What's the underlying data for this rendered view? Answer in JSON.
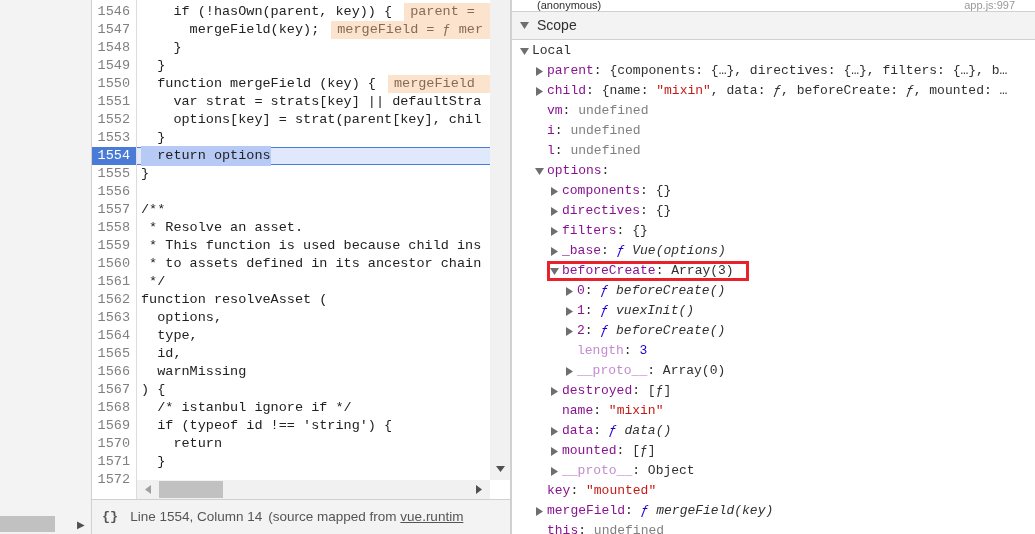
{
  "navigator": {
    "arrow": "▶"
  },
  "editor": {
    "lines": [
      {
        "number": "1546",
        "code": "    if (!hasOwn(parent, key)) {",
        "inline_value": "parent = ",
        "current": false
      },
      {
        "number": "1547",
        "code": "      mergeField(key);",
        "inline_value": "mergeField = ƒ mer",
        "current": false
      },
      {
        "number": "1548",
        "code": "    }",
        "current": false
      },
      {
        "number": "1549",
        "code": "  }",
        "current": false
      },
      {
        "number": "1550",
        "code": "  function mergeField (key) {",
        "inline_value": "mergeField ",
        "current": false
      },
      {
        "number": "1551",
        "code": "    var strat = strats[key] || defaultStra",
        "current": false
      },
      {
        "number": "1552",
        "code": "    options[key] = strat(parent[key], chil",
        "current": false
      },
      {
        "number": "1553",
        "code": "  }",
        "current": false
      },
      {
        "number": "1554",
        "code": "  return options",
        "current": true
      },
      {
        "number": "1555",
        "code": "}",
        "current": false
      },
      {
        "number": "1556",
        "current": false
      },
      {
        "number": "1557",
        "code": "/**",
        "current": false
      },
      {
        "number": "1558",
        "code": " * Resolve an asset.",
        "current": false
      },
      {
        "number": "1559",
        "code": " * This function is used because child ins",
        "current": false
      },
      {
        "number": "1560",
        "code": " * to assets defined in its ancestor chain",
        "current": false
      },
      {
        "number": "1561",
        "code": " */",
        "current": false
      },
      {
        "number": "1562",
        "code": "function resolveAsset (",
        "current": false
      },
      {
        "number": "1563",
        "code": "  options,",
        "current": false
      },
      {
        "number": "1564",
        "code": "  type,",
        "current": false
      },
      {
        "number": "1565",
        "code": "  id,",
        "current": false
      },
      {
        "number": "1566",
        "code": "  warnMissing",
        "current": false
      },
      {
        "number": "1567",
        "code": ") {",
        "current": false
      },
      {
        "number": "1568",
        "code": "  /* istanbul ignore if */",
        "current": false
      },
      {
        "number": "1569",
        "code": "  if (typeof id !== 'string') {",
        "current": false
      },
      {
        "number": "1570",
        "code": "    return",
        "current": false
      },
      {
        "number": "1571",
        "code": "  }",
        "current": false
      },
      {
        "number": "1572",
        "current": false
      }
    ]
  },
  "status_bar": {
    "format_icon": "{}",
    "position": "Line 1554, Column 14",
    "source_prefix": "(source mapped from ",
    "source_link": "vue.runtim"
  },
  "call_stack": {
    "frame": "(anonymous)",
    "location": "app.js:997"
  },
  "scope": {
    "title": "Scope",
    "expanded": true,
    "tree": [
      {
        "key": "Local",
        "kind": "section",
        "expanded": true,
        "boxed": false,
        "children": [
          {
            "key": "parent",
            "separator": ":",
            "dimmed": false,
            "expanded": false,
            "boxed": false,
            "value": [
              {
                "text": "{components: {…}, directives: {…}, filters: {…}, b…",
                "kind": "plain"
              }
            ]
          },
          {
            "key": "child",
            "separator": ":",
            "dimmed": false,
            "expanded": false,
            "boxed": false,
            "value": [
              {
                "text": "{name: ",
                "kind": "plain"
              },
              {
                "text": "\"mixin\"",
                "kind": "string"
              },
              {
                "text": ", data: ",
                "kind": "plain"
              },
              {
                "text": "ƒ",
                "kind": "fname"
              },
              {
                "text": ", beforeCreate: ",
                "kind": "plain"
              },
              {
                "text": "ƒ",
                "kind": "fname"
              },
              {
                "text": ", mounted: …",
                "kind": "plain"
              }
            ]
          },
          {
            "key": "vm",
            "separator": ":",
            "dimmed": false,
            "boxed": false,
            "value": [
              {
                "text": "undefined",
                "kind": "undefined"
              }
            ]
          },
          {
            "key": "i",
            "separator": ":",
            "dimmed": false,
            "boxed": false,
            "value": [
              {
                "text": "undefined",
                "kind": "undefined"
              }
            ]
          },
          {
            "key": "l",
            "separator": ":",
            "dimmed": false,
            "boxed": false,
            "value": [
              {
                "text": "undefined",
                "kind": "undefined"
              }
            ]
          },
          {
            "key": "options",
            "separator": ":",
            "dimmed": false,
            "expanded": true,
            "boxed": false,
            "children": [
              {
                "key": "components",
                "separator": ":",
                "dimmed": false,
                "expanded": false,
                "boxed": false,
                "value": [
                  {
                    "text": "{}",
                    "kind": "plain"
                  }
                ]
              },
              {
                "key": "directives",
                "separator": ":",
                "dimmed": false,
                "expanded": false,
                "boxed": false,
                "value": [
                  {
                    "text": "{}",
                    "kind": "plain"
                  }
                ]
              },
              {
                "key": "filters",
                "separator": ":",
                "dimmed": false,
                "expanded": false,
                "boxed": false,
                "value": [
                  {
                    "text": "{}",
                    "kind": "plain"
                  }
                ]
              },
              {
                "key": "_base",
                "separator": ":",
                "dimmed": false,
                "expanded": false,
                "boxed": false,
                "value": [
                  {
                    "text": "ƒ",
                    "kind": "fn"
                  },
                  {
                    "text": "Vue(options)",
                    "kind": "fname"
                  }
                ]
              },
              {
                "key": "beforeCreate",
                "separator": ":",
                "dimmed": false,
                "expanded": true,
                "boxed": true,
                "value": [
                  {
                    "text": "Array(3)",
                    "kind": "plain"
                  }
                ],
                "children": [
                  {
                    "key": "0",
                    "separator": ":",
                    "dimmed": false,
                    "expanded": false,
                    "boxed": false,
                    "value": [
                      {
                        "text": "ƒ",
                        "kind": "fn"
                      },
                      {
                        "text": "beforeCreate()",
                        "kind": "fname"
                      }
                    ]
                  },
                  {
                    "key": "1",
                    "separator": ":",
                    "dimmed": false,
                    "expanded": false,
                    "boxed": false,
                    "value": [
                      {
                        "text": "ƒ",
                        "kind": "fn"
                      },
                      {
                        "text": "vuexInit()",
                        "kind": "fname"
                      }
                    ]
                  },
                  {
                    "key": "2",
                    "separator": ":",
                    "dimmed": false,
                    "expanded": false,
                    "boxed": false,
                    "value": [
                      {
                        "text": "ƒ",
                        "kind": "fn"
                      },
                      {
                        "text": "beforeCreate()",
                        "kind": "fname"
                      }
                    ]
                  },
                  {
                    "key": "length",
                    "separator": ":",
                    "dimmed": true,
                    "boxed": false,
                    "value": [
                      {
                        "text": "3",
                        "kind": "number"
                      }
                    ]
                  },
                  {
                    "key": "__proto__",
                    "separator": ":",
                    "dimmed": true,
                    "expanded": false,
                    "boxed": false,
                    "value": [
                      {
                        "text": "Array(0)",
                        "kind": "plain"
                      }
                    ]
                  }
                ]
              },
              {
                "key": "destroyed",
                "separator": ":",
                "dimmed": false,
                "expanded": false,
                "boxed": false,
                "value": [
                  {
                    "text": "[ƒ]",
                    "kind": "plain"
                  }
                ]
              },
              {
                "key": "name",
                "separator": ":",
                "dimmed": false,
                "boxed": false,
                "value": [
                  {
                    "text": "\"mixin\"",
                    "kind": "string"
                  }
                ]
              },
              {
                "key": "data",
                "separator": ":",
                "dimmed": false,
                "expanded": false,
                "boxed": false,
                "value": [
                  {
                    "text": "ƒ",
                    "kind": "fn"
                  },
                  {
                    "text": "data()",
                    "kind": "fname"
                  }
                ]
              },
              {
                "key": "mounted",
                "separator": ":",
                "dimmed": false,
                "expanded": false,
                "boxed": false,
                "value": [
                  {
                    "text": "[ƒ]",
                    "kind": "plain"
                  }
                ]
              },
              {
                "key": "__proto__",
                "separator": ":",
                "dimmed": true,
                "expanded": false,
                "boxed": false,
                "value": [
                  {
                    "text": "Object",
                    "kind": "plain"
                  }
                ]
              }
            ]
          },
          {
            "key": "key",
            "separator": ":",
            "dimmed": false,
            "boxed": false,
            "value": [
              {
                "text": "\"mounted\"",
                "kind": "string"
              }
            ]
          },
          {
            "key": "mergeField",
            "separator": ":",
            "dimmed": false,
            "expanded": false,
            "boxed": false,
            "value": [
              {
                "text": "ƒ",
                "kind": "fn"
              },
              {
                "text": "mergeField(key)",
                "kind": "fname"
              }
            ]
          },
          {
            "key": "this",
            "separator": ":",
            "dimmed": false,
            "boxed": false,
            "value": [
              {
                "text": "undefined",
                "kind": "undefined"
              }
            ]
          }
        ]
      }
    ]
  }
}
